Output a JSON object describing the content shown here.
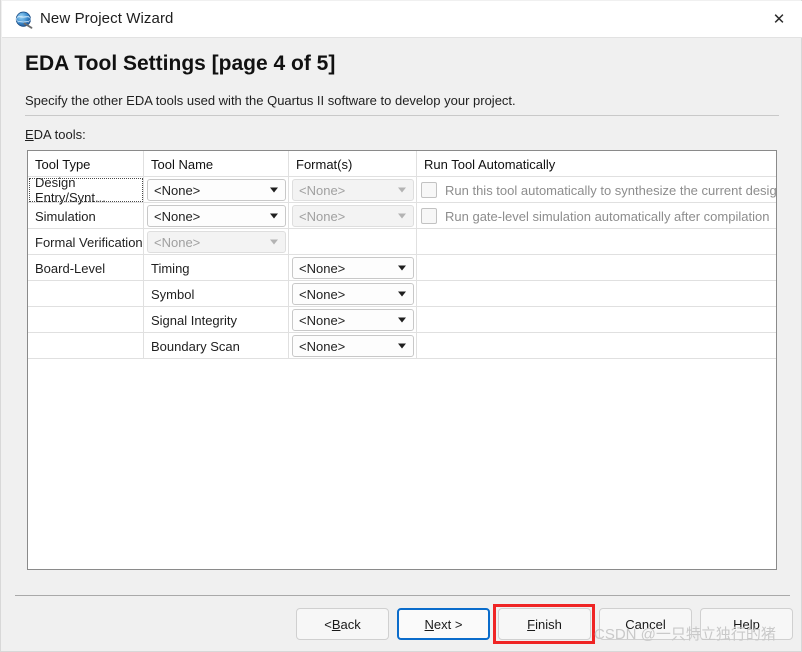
{
  "window": {
    "title": "New Project Wizard",
    "app_icon": "quartus-globe-icon",
    "close_icon": "✕"
  },
  "header": {
    "page_title": "EDA Tool Settings [page 4 of 5]",
    "description": "Specify the other EDA tools used with the Quartus II software to develop your project.",
    "table_label_mnemonic": "E",
    "table_label_rest": "DA tools:"
  },
  "table": {
    "columns": [
      "Tool Type",
      "Tool Name",
      "Format(s)",
      "Run Tool Automatically"
    ],
    "rows": [
      {
        "tool_type": "Design Entry/Synt...",
        "tool_type_focused": true,
        "tool_name": "<None>",
        "tool_name_kind": "combo",
        "tool_name_disabled": false,
        "format": "<None>",
        "format_kind": "combo",
        "format_disabled": true,
        "run_auto": "Run this tool automatically to synthesize the current design",
        "run_auto_checked": false,
        "run_auto_disabled": true
      },
      {
        "tool_type": "Simulation",
        "tool_type_focused": false,
        "tool_name": "<None>",
        "tool_name_kind": "combo",
        "tool_name_disabled": false,
        "format": "<None>",
        "format_kind": "combo",
        "format_disabled": true,
        "run_auto": "Run gate-level simulation automatically after compilation",
        "run_auto_checked": false,
        "run_auto_disabled": true
      },
      {
        "tool_type": "Formal Verification",
        "tool_type_focused": false,
        "tool_name": "<None>",
        "tool_name_kind": "combo",
        "tool_name_disabled": true,
        "format": "",
        "format_kind": "none",
        "format_disabled": false,
        "run_auto": "",
        "run_auto_checked": false,
        "run_auto_disabled": false
      },
      {
        "tool_type": "Board-Level",
        "tool_type_focused": false,
        "tool_name": "Timing",
        "tool_name_kind": "text",
        "tool_name_disabled": false,
        "format": "<None>",
        "format_kind": "combo",
        "format_disabled": false,
        "run_auto": "",
        "run_auto_checked": false,
        "run_auto_disabled": false
      },
      {
        "tool_type": "",
        "tool_type_focused": false,
        "tool_name": "Symbol",
        "tool_name_kind": "text",
        "tool_name_disabled": false,
        "format": "<None>",
        "format_kind": "combo",
        "format_disabled": false,
        "run_auto": "",
        "run_auto_checked": false,
        "run_auto_disabled": false
      },
      {
        "tool_type": "",
        "tool_type_focused": false,
        "tool_name": "Signal Integrity",
        "tool_name_kind": "text",
        "tool_name_disabled": false,
        "format": "<None>",
        "format_kind": "combo",
        "format_disabled": false,
        "run_auto": "",
        "run_auto_checked": false,
        "run_auto_disabled": false
      },
      {
        "tool_type": "",
        "tool_type_focused": false,
        "tool_name": "Boundary Scan",
        "tool_name_kind": "text",
        "tool_name_disabled": false,
        "format": "<None>",
        "format_kind": "combo",
        "format_disabled": false,
        "run_auto": "",
        "run_auto_checked": false,
        "run_auto_disabled": false
      }
    ]
  },
  "footer": {
    "buttons": [
      {
        "id": "back",
        "label": "< Back",
        "mnemonic": "B",
        "focused": false,
        "highlighted": false
      },
      {
        "id": "next",
        "label": "Next >",
        "mnemonic": "N",
        "focused": true,
        "highlighted": false
      },
      {
        "id": "finish",
        "label": "Finish",
        "mnemonic": "F",
        "focused": false,
        "highlighted": true
      },
      {
        "id": "cancel",
        "label": "Cancel",
        "mnemonic": "",
        "focused": false,
        "highlighted": false
      },
      {
        "id": "help",
        "label": "Help",
        "mnemonic": "",
        "focused": false,
        "highlighted": false
      }
    ],
    "highlight_color": "#ef2424"
  },
  "watermark": {
    "text": "CSDN @一只特立独行的猪"
  }
}
